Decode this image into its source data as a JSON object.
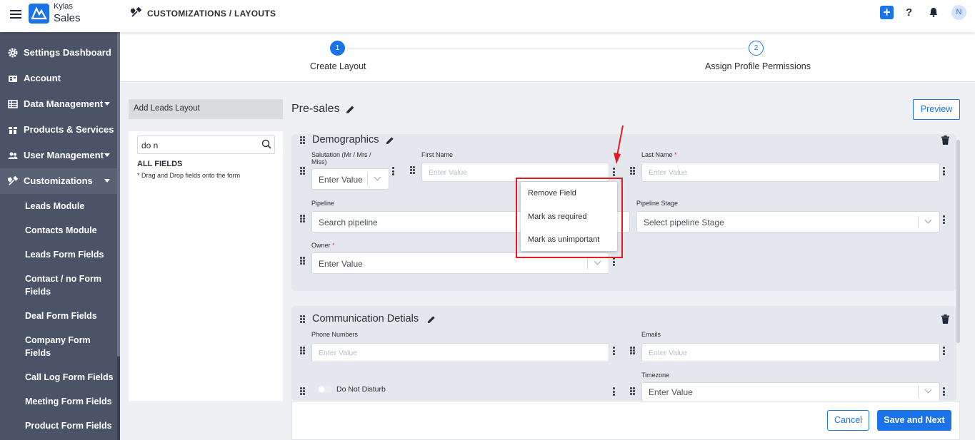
{
  "header": {
    "brand_top": "Kylas",
    "brand_bottom": "Sales",
    "breadcrumb": "CUSTOMIZATIONS / LAYOUTS",
    "help": "?",
    "avatar": "N",
    "accent": "#1a73e8"
  },
  "sidebar": {
    "items": [
      {
        "label": "Settings Dashboard",
        "icon": "gear-icon"
      },
      {
        "label": "Account",
        "icon": "building-icon"
      },
      {
        "label": "Data Management",
        "icon": "table-icon"
      },
      {
        "label": "Products & Services",
        "icon": "box-icon"
      },
      {
        "label": "User Management",
        "icon": "users-icon"
      },
      {
        "label": "Customizations",
        "icon": "tools-icon"
      }
    ],
    "subitems": [
      "Leads Module",
      "Contacts Module",
      "Leads Form Fields",
      "Contact / no Form Fields",
      "Deal Form Fields",
      "Company Form Fields",
      "Call Log Form Fields",
      "Meeting Form Fields",
      "Product Form Fields"
    ]
  },
  "stepper": {
    "steps": [
      {
        "num": "1",
        "label": "Create Layout"
      },
      {
        "num": "2",
        "label": "Assign Profile Permissions"
      }
    ]
  },
  "left_panel": {
    "title": "Add Leads Layout",
    "search_value": "do n",
    "all_fields": "ALL FIELDS",
    "hint": "* Drag and Drop fields onto the form"
  },
  "main": {
    "layout_name": "Pre-sales",
    "preview": "Preview",
    "sections": [
      {
        "title": "Demographics",
        "fields": {
          "salutation_label": "Salutation (Mr / Mrs / Miss)",
          "salutation_value": "Enter Value",
          "first_name_label": "First Name",
          "first_name_placeholder": "Enter Value",
          "last_name_label": "Last Name",
          "last_name_placeholder": "Enter Value",
          "pipeline_label": "Pipeline",
          "pipeline_value": "Search pipeline",
          "pipeline_stage_label": "Pipeline Stage",
          "pipeline_stage_value": "Select pipeline Stage",
          "owner_label": "Owner",
          "owner_value": "Enter Value",
          "required_mark": "*"
        }
      },
      {
        "title": "Communication Detials",
        "fields": {
          "phone_label": "Phone Numbers",
          "phone_placeholder": "Enter Value",
          "emails_label": "Emails",
          "emails_placeholder": "Enter Value",
          "dnd_label": "Do Not Disturb",
          "timezone_label": "Timezone",
          "timezone_value": "Enter Value"
        }
      }
    ],
    "context_menu": [
      "Remove Field",
      "Mark as required",
      "Mark as unimportant"
    ]
  },
  "footer": {
    "cancel": "Cancel",
    "save_next": "Save and Next"
  }
}
